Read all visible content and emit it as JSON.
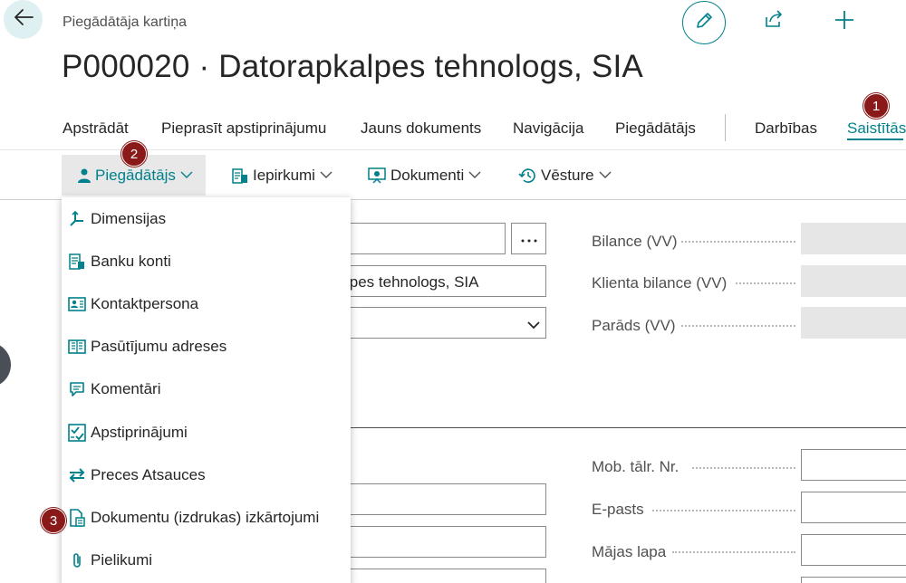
{
  "header": {
    "caption": "Piegādātāja kartiņa",
    "title": "P000020 · Datorapkalpes tehnologs, SIA"
  },
  "actionbar": {
    "items": [
      "Apstrādāt",
      "Pieprasīt apstiprinājumu",
      "Jauns dokuments",
      "Navigācija",
      "Piegādātājs",
      "Darbības",
      "Saistītās"
    ],
    "active": "Saistītās"
  },
  "subbar": {
    "items": [
      "Piegādātājs",
      "Iepirkumi",
      "Dokumenti",
      "Vēsture"
    ]
  },
  "dropdown": {
    "items": [
      {
        "label": "Dimensijas",
        "icon": "dimensions-icon"
      },
      {
        "label": "Banku konti",
        "icon": "bank-accounts-icon"
      },
      {
        "label": "Kontaktpersona",
        "icon": "contact-card-icon"
      },
      {
        "label": "Pasūtījumu adreses",
        "icon": "order-address-icon"
      },
      {
        "label": "Komentāri",
        "icon": "comment-icon"
      },
      {
        "label": "Apstiprinājumi",
        "icon": "approvals-icon"
      },
      {
        "label": "Preces Atsauces",
        "icon": "item-references-icon"
      },
      {
        "label": "Dokumentu (izdrukas) izkārtojumi",
        "icon": "document-layout-icon"
      },
      {
        "label": "Pielikumi",
        "icon": "attachment-icon"
      }
    ]
  },
  "form": {
    "name_value_partial": "lpes tehnologs, SIA",
    "right_labels": [
      "Bilance (VV)",
      "Klienta bilance (VV)",
      "Parāds (VV)"
    ],
    "contact_labels": [
      "Mob. tālr. Nr.",
      "E-pasts",
      "Mājas lapa"
    ]
  },
  "badges": [
    "1",
    "2",
    "3"
  ],
  "colors": {
    "accent": "#00818b",
    "badge": "#8a1a1a",
    "readonly_fill": "#e6e6e6",
    "back_button_bg": "#dff0f2"
  }
}
